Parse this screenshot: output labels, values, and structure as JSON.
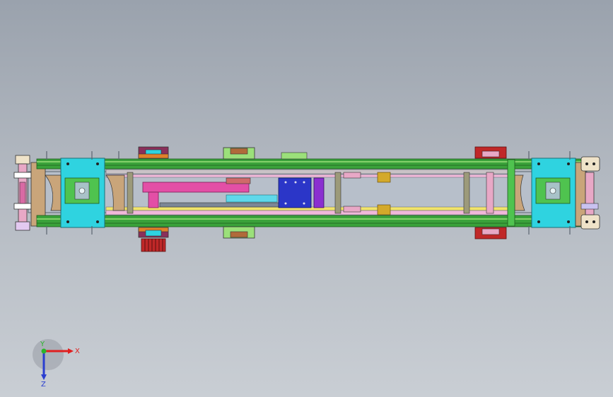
{
  "viewport": {
    "background_top": "#9aa2ad",
    "background_bottom": "#c9ced4"
  },
  "model": {
    "description_icon": "cad-assembly-top-view",
    "colors": {
      "rail_green": "#3aa23a",
      "rail_light": "#9be07a",
      "plate_cyan": "#2fd3e0",
      "bracket_pink": "#e34fa6",
      "motor_blue": "#2b36c8",
      "motor_purple": "#8a2fd0",
      "bearing_red": "#c02828",
      "bearing_gold": "#d4a92a",
      "bearing_orange": "#e0802a",
      "wood_tan": "#c9a57a",
      "frame_gray": "#7d8796",
      "shaft_olive": "#9c9a7a",
      "cam_white": "#efe3c9"
    }
  },
  "triad": {
    "x_label": "X",
    "y_label": "Y",
    "z_label": "Z",
    "x_color": "#e02020",
    "y_color": "#2bb52b",
    "z_color": "#2a3ed0"
  }
}
